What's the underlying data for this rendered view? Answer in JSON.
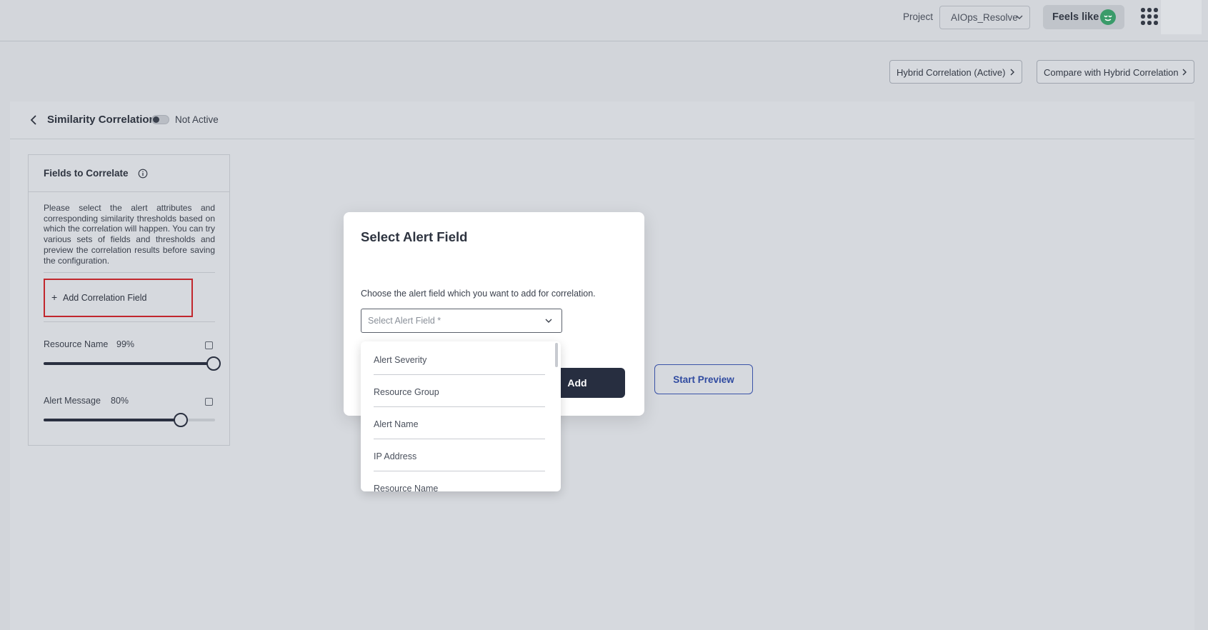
{
  "topbar": {
    "project_label": "Project",
    "project_value": "AIOps_Resolve",
    "feels_like_label": "Feels like"
  },
  "actions": {
    "hybrid_active_label": "Hybrid Correlation (Active)",
    "compare_label": "Compare with Hybrid Correlation"
  },
  "header": {
    "title": "Similarity Correlation",
    "status": "Not Active",
    "toggle_on": false
  },
  "fields_card": {
    "title": "Fields to Correlate",
    "description": "Please select the alert attributes and corresponding similarity thresholds based on which the correlation will happen. You can try various sets of fields and thresholds and preview the correlation results before saving the configuration.",
    "add_field_label": "Add Correlation Field",
    "fields": [
      {
        "name": "Resource Name",
        "threshold_label": "99%",
        "threshold": 99,
        "checked": false
      },
      {
        "name": "Alert Message",
        "threshold_label": "80%",
        "threshold": 80,
        "checked": false
      }
    ]
  },
  "dialog": {
    "title": "Select Alert Field",
    "subtitle": "Choose the alert field which you want to add for correlation.",
    "select_placeholder": "Select Alert Field *",
    "add_label": "Add",
    "options": [
      "Alert Severity",
      "Resource Group",
      "Alert Name",
      "IP Address",
      "Resource Name"
    ]
  },
  "preview": {
    "start_label": "Start Preview"
  },
  "colors": {
    "background": "#d2d5da",
    "dark_button": "#272e40",
    "highlight_border": "#c1272d",
    "link_blue": "#2f4aa0",
    "smiley_green": "#3a9b6a"
  },
  "icons": [
    "chevron-down-icon",
    "smiley-icon",
    "apps-grid-icon",
    "chevron-right-icon",
    "back-arrow-icon",
    "info-icon",
    "plus-icon",
    "checkbox-icon"
  ]
}
